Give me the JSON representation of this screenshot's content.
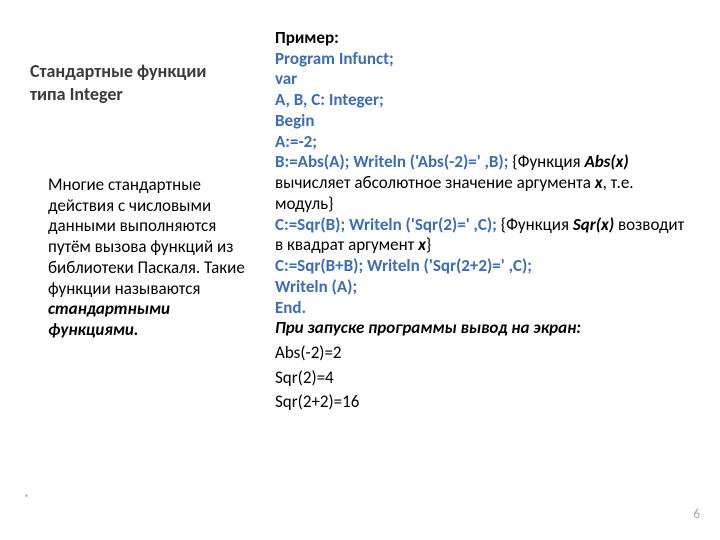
{
  "left": {
    "title": "Стандартные функции типа Integer",
    "paragraph_a": "Многие стандартные действия с числовыми данными выполняются путём вызова функций из библиотеки Паскаля. Такие функции называются ",
    "paragraph_em": "стандартными функциями."
  },
  "right": {
    "header": "Пример:",
    "l1": "Program Infunct;",
    "l2": "var",
    "l3": "A, B, C: Integer;",
    "l4": "Begin",
    "l5": "A:=-2;",
    "l6a": "B:=Abs(A); Writeln ('Abs(-2)=' ,B);",
    "l6b1": " {Функция ",
    "l6b2": "Abs(x)",
    "l6b3": " вычисляет абсолютное значение аргумента ",
    "l6b4": "x",
    "l6b5": ", т.е. модуль}",
    "l7a": "C:=Sqr(B); Writeln ('Sqr(2)=' ,C);",
    "l7b1": " {Функция ",
    "l7b2": "Sqr(x)",
    "l7b3": " возводит в квадрат аргумент ",
    "l7b4": "x",
    "l7b5": "}",
    "l8": "C:=Sqr(B+B); Writeln ('Sqr(2+2)=' ,C);",
    "l9": "Writeln (A);",
    "l10": "End.",
    "out_header": "При запуске программы вывод на экран:",
    "out1": "Abs(-2)=2",
    "out2": "Sqr(2)=4",
    "out3": "Sqr(2+2)=16"
  },
  "page_number": "6",
  "bullet": "*"
}
